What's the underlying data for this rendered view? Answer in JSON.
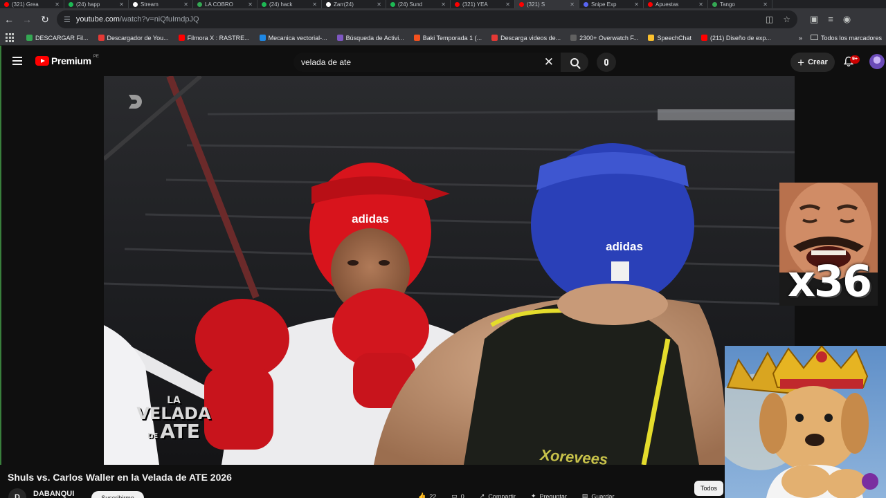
{
  "browser": {
    "tabs": [
      {
        "title": "(321) Grea",
        "color": "#ff0000"
      },
      {
        "title": "(24) happ",
        "color": "#1db954"
      },
      {
        "title": "Stream",
        "color": "#ffffff"
      },
      {
        "title": "LA COBRO",
        "color": "#34a853"
      },
      {
        "title": "(24) hack",
        "color": "#1db954"
      },
      {
        "title": "Zarr(24)",
        "color": "#ffffff"
      },
      {
        "title": "(24) Sund",
        "color": "#1db954"
      },
      {
        "title": "(321) YEA",
        "color": "#ff0000"
      },
      {
        "title": "(321) S",
        "color": "#ff0000"
      },
      {
        "title": "Snipe Exp",
        "color": "#5865f2"
      },
      {
        "title": "Apuestas",
        "color": "#ff0000"
      },
      {
        "title": "Tango",
        "color": "#34a853"
      }
    ],
    "url_host": "youtube.com",
    "url_path": "/watch?v=niQfuImdpJQ",
    "bookmarks": [
      {
        "label": "DESCARGAR Fil...",
        "color": "#34a853"
      },
      {
        "label": "Descargador de You...",
        "color": "#e53935"
      },
      {
        "label": "Filmora X : RASTRE...",
        "color": "#ff0000"
      },
      {
        "label": "Mecanica vectorial-...",
        "color": "#1e88e5"
      },
      {
        "label": "Búsqueda de Activi...",
        "color": "#7e57c2"
      },
      {
        "label": "Baki Temporada 1 (...",
        "color": "#f4511e"
      },
      {
        "label": "Descarga videos de...",
        "color": "#e53935"
      },
      {
        "label": "2300+ Overwatch F...",
        "color": "#616161"
      },
      {
        "label": "SpeechChat",
        "color": "#fbc02d"
      },
      {
        "label": "(211) Diseño de exp...",
        "color": "#ff0000"
      }
    ],
    "more_bookmarks": "»",
    "all_bookmarks": "Todos los marcadores"
  },
  "youtube": {
    "logo_text": "Premium",
    "country_code": "PE",
    "search_query": "velada de ate",
    "create_label": "Crear",
    "notifications_badge": "9+"
  },
  "video": {
    "title": "Shuls vs. Carlos Waller en la Velada de ATE 2026",
    "channel": "DABANQUI",
    "subscribe_label": "Suscribirme",
    "overlay_logo_line1": "LA",
    "overlay_logo_line2": "VELADA",
    "overlay_logo_line3": "DE",
    "overlay_logo_line4": "ATE",
    "glove_brand": "adidas",
    "shirt_text": "Xorevees"
  },
  "overlays": {
    "counter_text": "x36"
  },
  "actions": [
    {
      "label": "22",
      "icon": "like-icon"
    },
    {
      "label": "0",
      "icon": "comment-icon"
    },
    {
      "label": "Compartir",
      "icon": "share-icon"
    },
    {
      "label": "Preguntar",
      "icon": "sparkle-icon"
    },
    {
      "label": "Guardar",
      "icon": "save-icon"
    }
  ],
  "chip_label": "Todos",
  "colors": {
    "brand_red": "#ff0000",
    "background": "#0f0f0f",
    "red_fighter": "#d8141c",
    "blue_fighter": "#2a40b8"
  }
}
